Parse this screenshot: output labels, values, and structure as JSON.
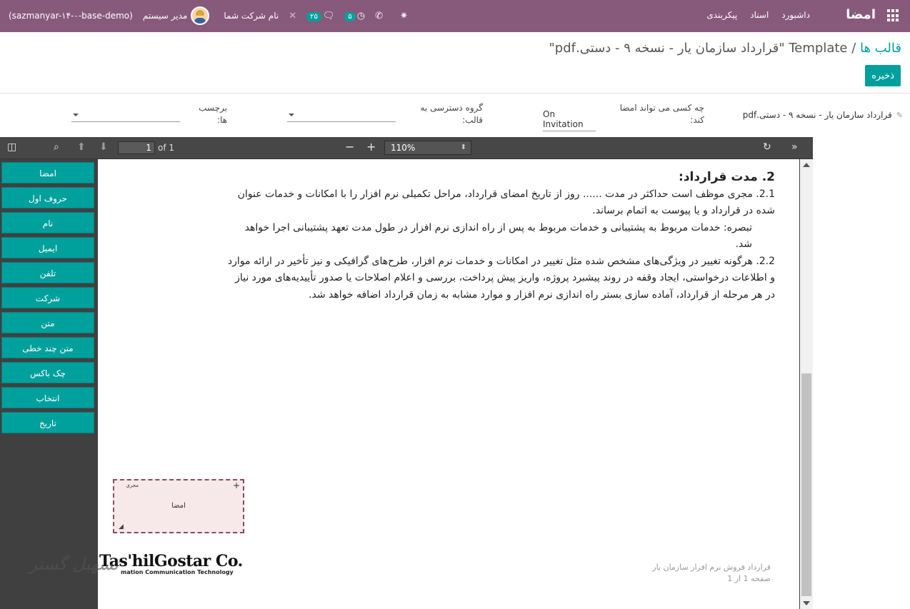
{
  "navbar": {
    "brand": "امضا",
    "menu": [
      "داشبورد",
      "اسناد",
      "پیکربندی"
    ],
    "company": "نام شرکت شما",
    "user": "مدیر سیستم",
    "database": "(sazmanyar-۱۴-۰-base-demo)",
    "activity_count": "۵",
    "message_count": "۲۵",
    "icons": [
      "apps-icon",
      "bug-icon",
      "phone-icon",
      "clock-icon",
      "chat-icon",
      "close-icon"
    ]
  },
  "breadcrumb": {
    "parent": "قالب ها",
    "separator": "/",
    "current": "Template \"قرارداد سازمان یار - نسخه ۹ - دستی.pdf\""
  },
  "actions": {
    "save": "ذخیره"
  },
  "fields": {
    "template_name": "قرارداد سازمان یار - نسخه ۹ - دستی.pdf",
    "who_can_sign_label": "چه کسی می تواند امضا کند:",
    "who_can_sign_value": "On Invitation",
    "access_group_label": "گروه دسترسی به قالب:",
    "tags_label": "برچسب ها:"
  },
  "viewer": {
    "page_number": "1",
    "page_count": "of 1",
    "zoom": "110%",
    "toolbar_icons": [
      "sidebar-toggle-icon",
      "search-icon",
      "previous-page-icon",
      "next-page-icon",
      "zoom-out-icon",
      "zoom-in-icon",
      "refresh-icon",
      "tools-icon"
    ]
  },
  "sidebar_fields": [
    "امضا",
    "حروف اول",
    "نام",
    "ایمیل",
    "تلفن",
    "شرکت",
    "متن",
    "متن چند خطی",
    "چک باکس",
    "انتخاب",
    "تاریخ"
  ],
  "document": {
    "heading": "2. مدت قرارداد:",
    "item1": "2.1. مجری موظف است حداکثر در مدت ...... روز از تاریخ امضای قرارداد، مراحل تکمیلی نرم افزار را با امکانات و خدمات عنوان شده در قرارداد و یا پیوست به اتمام برساند.",
    "note": "تبصره: خدمات مربوط به پشتیبانی و خدمات مربوط به پس از راه اندازی نرم افزار در طول مدت تعهد پشتیبانی اجرا خواهد شد.",
    "item2": "2.2. هرگونه تغییر در ویژگی‌های مشخص شده مثل تغییر در امکانات و خدمات نرم افزار، طرح‌های گرافیکی و نیز تأخیر در ارائه موارد و اطلاعات درخواستی، ایجاد وقفه در روند پیشبرد پروژه، واریز پیش پرداخت، بررسی و اعلام اصلاحات یا صدور تأییدیه‌های مورد نیاز در هر مرحله از قرارداد، آماده سازی بستر راه اندازی نرم افزار و موارد مشابه به زمان قرارداد اضافه خواهد شد.",
    "signature_role": "مجری",
    "signature_label": "امضا",
    "footer_line1": "قرارداد فروش نرم افزار سازمان یار",
    "footer_line2": "صفحه 1 از 1",
    "logo_main": "Tas'hilGostar Co.",
    "logo_sub": "mation Communication Technology"
  },
  "watermark": "تسهیل گستر"
}
